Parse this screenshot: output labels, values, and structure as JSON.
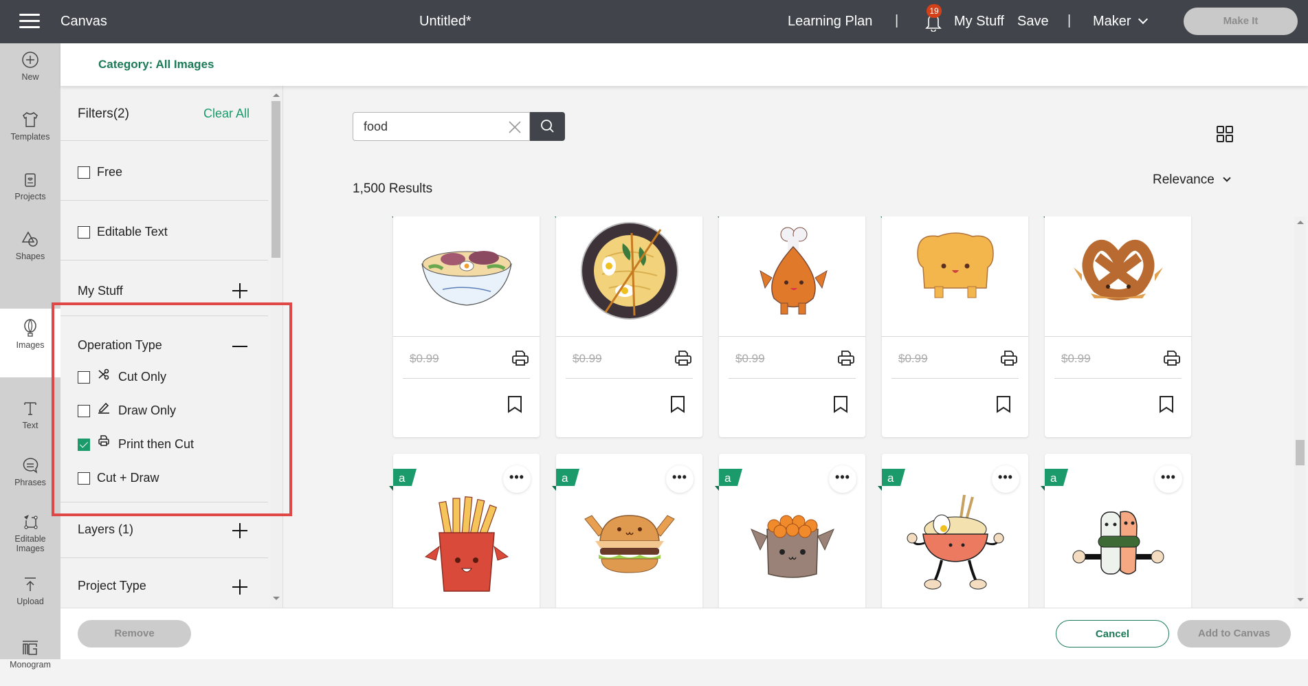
{
  "topbar": {
    "app_title": "Canvas",
    "doc_title": "Untitled*",
    "learning_plan": "Learning Plan",
    "separator": "|",
    "notification_count": "19",
    "my_stuff": "My Stuff",
    "save": "Save",
    "machine": "Maker",
    "make_it": "Make It"
  },
  "rail": {
    "items": [
      {
        "label": "New",
        "icon": "plus-circle-icon"
      },
      {
        "label": "Templates",
        "icon": "tshirt-icon"
      },
      {
        "label": "Projects",
        "icon": "card-heart-icon"
      },
      {
        "label": "Shapes",
        "icon": "shapes-icon"
      },
      {
        "label": "Images",
        "icon": "balloon-icon",
        "active": true
      },
      {
        "label": "Text",
        "icon": "text-t-icon"
      },
      {
        "label": "Phrases",
        "icon": "speech-bubble-icon"
      },
      {
        "label": "Editable",
        "label2": "Images",
        "icon": "editable-image-icon"
      },
      {
        "label": "Upload",
        "icon": "upload-icon"
      },
      {
        "label": "Monogram",
        "icon": "monogram-icon"
      }
    ]
  },
  "category": "Category: All Images",
  "filters": {
    "title": "Filters(2)",
    "clear_all": "Clear All",
    "free": {
      "label": "Free",
      "checked": false
    },
    "editable_text": {
      "label": "Editable Text",
      "checked": false
    },
    "my_stuff": "My Stuff",
    "operation_type": {
      "title": "Operation Type",
      "options": [
        {
          "label": "Cut Only",
          "icon": "scissors-icon",
          "checked": false
        },
        {
          "label": "Draw Only",
          "icon": "pen-icon",
          "checked": false
        },
        {
          "label": "Print then Cut",
          "icon": "printer-icon",
          "checked": true
        },
        {
          "label": "Cut + Draw",
          "checked": false
        }
      ]
    },
    "layers": "Layers (1)",
    "project_type": "Project Type"
  },
  "search": {
    "value": "food",
    "placeholder": "Search"
  },
  "results_count": "1,500 Results",
  "sort": "Relevance",
  "cards_row1": [
    {
      "name": "ramen-bowl-watercolor",
      "price": "$0.99"
    },
    {
      "name": "noodle-bowl-chopsticks",
      "price": "$0.99"
    },
    {
      "name": "kawaii-drumstick",
      "price": "$0.99"
    },
    {
      "name": "kawaii-bread-loaf",
      "price": "$0.99"
    },
    {
      "name": "kawaii-pretzel",
      "price": "$0.99"
    }
  ],
  "cards_row2": [
    {
      "name": "kawaii-french-fries",
      "flag": "a",
      "more": "•••"
    },
    {
      "name": "kawaii-burger",
      "flag": "a",
      "more": "•••"
    },
    {
      "name": "kawaii-ikura-sushi",
      "flag": "a",
      "more": "•••"
    },
    {
      "name": "retro-ramen-bowl-character",
      "flag": "a",
      "more": "•••"
    },
    {
      "name": "retro-sushi-duo",
      "flag": "a",
      "more": "•••"
    }
  ],
  "bottom": {
    "remove": "Remove",
    "cancel": "Cancel",
    "add_to_canvas": "Add to Canvas"
  },
  "colors": {
    "brand_green": "#1b9a6c",
    "topbar": "#41454b",
    "highlight": "#e04848",
    "badge": "#d44018"
  }
}
